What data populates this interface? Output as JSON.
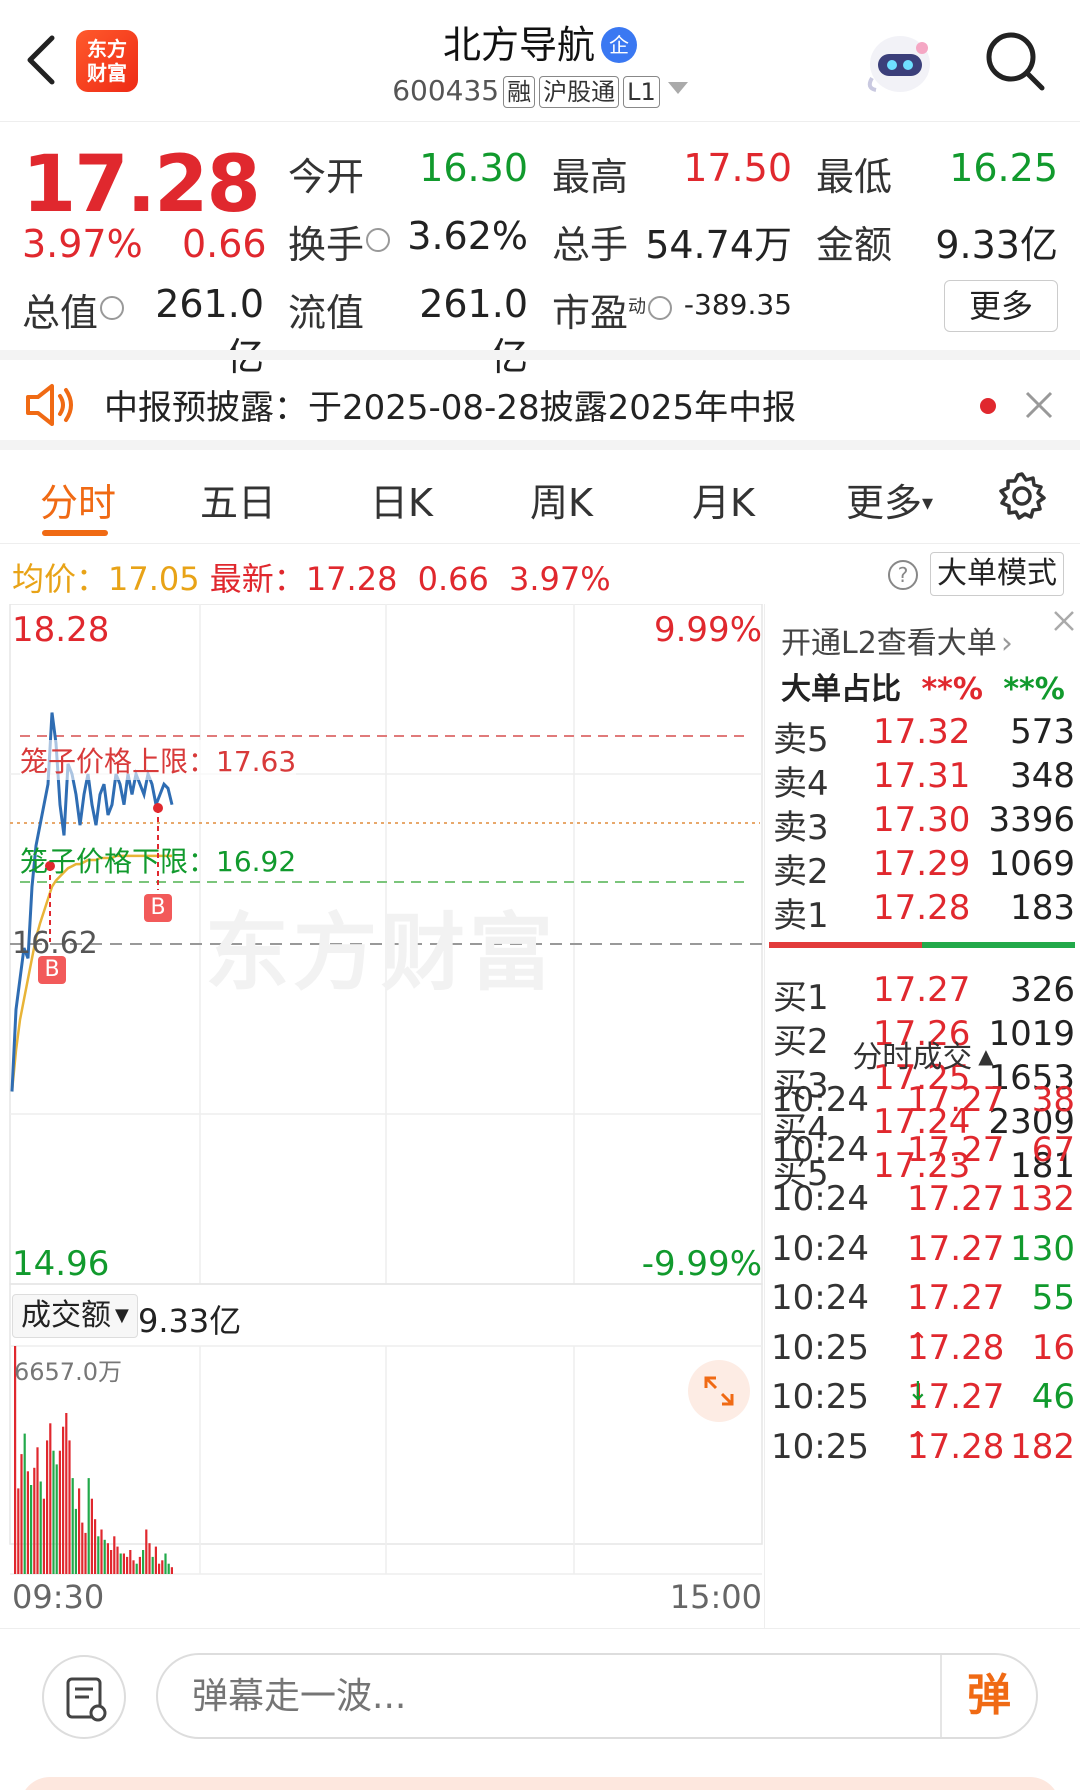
{
  "header": {
    "logo_line1": "东方",
    "logo_line2": "财富",
    "stock_name": "北方导航",
    "badge": "企",
    "code": "600435",
    "tags": [
      "融",
      "沪股通",
      "L1"
    ]
  },
  "quote": {
    "price": "17.28",
    "change_pct": "3.97%",
    "change": "0.66",
    "fields": [
      {
        "label": "今开",
        "value": "16.30",
        "color": "green"
      },
      {
        "label": "最高",
        "value": "17.50",
        "color": "red"
      },
      {
        "label": "最低",
        "value": "16.25",
        "color": "green"
      },
      {
        "label": "换手",
        "value": "3.62%",
        "color": "black"
      },
      {
        "label": "总手",
        "value": "54.74万",
        "color": "black"
      },
      {
        "label": "金额",
        "value": "9.33亿",
        "color": "black"
      },
      {
        "label": "总值",
        "value": "261.0亿",
        "color": "black"
      },
      {
        "label": "流值",
        "value": "261.0亿",
        "color": "black"
      },
      {
        "label": "市盈",
        "value": "-389.35",
        "color": "black"
      }
    ],
    "pe_sup": "动",
    "more": "更多"
  },
  "notice": {
    "text": "中报预披露：于2025-08-28披露2025年中报"
  },
  "tabs": [
    "分时",
    "五日",
    "日K",
    "周K",
    "月K",
    "更多"
  ],
  "infobar": {
    "avg_label": "均价：",
    "avg_value": "17.05",
    "latest_label": "最新：",
    "latest_value": "17.28",
    "change": "0.66",
    "change_pct": "3.97%",
    "help": "?",
    "mode": "大单模式"
  },
  "chart": {
    "y_top": "18.28",
    "y_top_pct": "9.99%",
    "y_bottom": "14.96",
    "y_bottom_pct": "-9.99%",
    "prev_close": "16.62",
    "upper_limit_label": "笼子价格上限：17.63",
    "lower_limit_label": "笼子价格下限：16.92",
    "marker": "B",
    "watermark": "东方财富",
    "volume_selector": "成交额",
    "volume_total": "9.33亿",
    "volume_max": "6657.0万",
    "time_start": "09:30",
    "time_end": "15:00"
  },
  "chart_data": {
    "type": "line",
    "ylim": [
      14.96,
      18.28
    ],
    "prev_close": 16.62,
    "series": [
      {
        "values": [
          15.9,
          16.3,
          16.45,
          16.6,
          16.55,
          16.9,
          17.1,
          17.2,
          17.3,
          17.4,
          17.75,
          17.6,
          17.3,
          17.15,
          17.5,
          17.45,
          17.35,
          17.2,
          17.35,
          17.45,
          17.3,
          17.2,
          17.35,
          17.4,
          17.25,
          17.3,
          17.45,
          17.4,
          17.3,
          17.45,
          17.35,
          17.45,
          17.4,
          17.35,
          17.45,
          17.4,
          17.3,
          17.35,
          17.4,
          17.38,
          17.3
        ]
      },
      {
        "values": [
          15.9,
          16.1,
          16.25,
          16.35,
          16.45,
          16.55,
          16.65,
          16.72,
          16.78,
          16.84,
          16.9,
          16.93,
          16.95,
          16.97,
          16.99,
          17.0,
          17.01,
          17.01,
          17.02,
          17.03,
          17.03,
          17.03,
          17.04,
          17.04,
          17.04,
          17.04,
          17.05,
          17.05,
          17.05,
          17.05,
          17.05,
          17.05,
          17.05,
          17.05,
          17.05,
          17.05,
          17.05,
          17.05,
          17.05,
          17.05,
          17.05
        ]
      }
    ],
    "volume": {
      "ymax": 6657.0,
      "values": [
        6657,
        2500,
        3500,
        4100,
        3000,
        2600,
        3100,
        3700,
        2700,
        2200,
        3900,
        4400,
        3600,
        3200,
        3600,
        4300,
        4700,
        3900,
        2800,
        1900,
        2500,
        1500,
        1200,
        2800,
        2200,
        1600,
        1100,
        1300,
        1000,
        900,
        700,
        1100,
        800,
        600,
        600,
        500,
        700,
        400,
        300,
        500,
        700,
        1300,
        900,
        500,
        800,
        300,
        400,
        600,
        300,
        200
      ]
    }
  },
  "book": {
    "promo": "开通L2查看大单",
    "big_order_label": "大单占比",
    "big_order_buy": "**%",
    "big_order_sell": "**%",
    "asks": [
      {
        "label": "卖5",
        "price": "17.32",
        "vol": "573"
      },
      {
        "label": "卖4",
        "price": "17.31",
        "vol": "348"
      },
      {
        "label": "卖3",
        "price": "17.30",
        "vol": "3396"
      },
      {
        "label": "卖2",
        "price": "17.29",
        "vol": "1069"
      },
      {
        "label": "卖1",
        "price": "17.28",
        "vol": "183"
      }
    ],
    "bids": [
      {
        "label": "买1",
        "price": "17.27",
        "vol": "326"
      },
      {
        "label": "买2",
        "price": "17.26",
        "vol": "1019"
      },
      {
        "label": "买3",
        "price": "17.25",
        "vol": "1653"
      },
      {
        "label": "买4",
        "price": "17.24",
        "vol": "2309"
      },
      {
        "label": "买5",
        "price": "17.23",
        "vol": "181"
      }
    ],
    "trades_title": "分时成交",
    "trades": [
      {
        "time": "10:24",
        "price": "17.27",
        "vol": "38",
        "vol_color": "red",
        "arrow": ""
      },
      {
        "time": "10:24",
        "price": "17.27",
        "vol": "67",
        "vol_color": "red",
        "arrow": ""
      },
      {
        "time": "10:24",
        "price": "17.27",
        "vol": "132",
        "vol_color": "red",
        "arrow": ""
      },
      {
        "time": "10:24",
        "price": "17.27",
        "vol": "130",
        "vol_color": "green",
        "arrow": ""
      },
      {
        "time": "10:24",
        "price": "17.27",
        "vol": "55",
        "vol_color": "green",
        "arrow": ""
      },
      {
        "time": "10:25",
        "price": "17.28",
        "vol": "16",
        "vol_color": "red",
        "arrow": "↑"
      },
      {
        "time": "10:25",
        "price": "17.27",
        "vol": "46",
        "vol_color": "green",
        "arrow": "↓"
      },
      {
        "time": "10:25",
        "price": "17.28",
        "vol": "182",
        "vol_color": "red",
        "arrow": "↑"
      }
    ]
  },
  "bottom": {
    "input_placeholder": "弹幕走一波...",
    "send": "弹"
  },
  "colors": {
    "red": "#e0282e",
    "green": "#119a2d",
    "accent": "#f06a14",
    "price_line": "#2f6db3",
    "avg_line": "#e8b437"
  }
}
